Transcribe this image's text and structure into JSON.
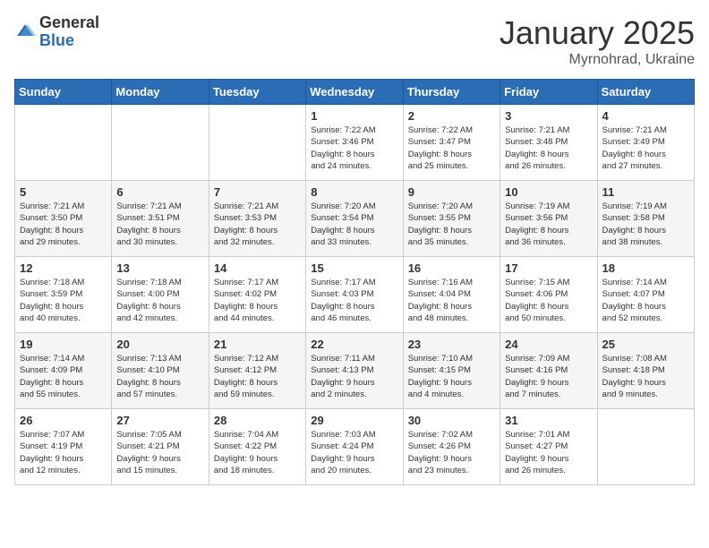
{
  "logo": {
    "general": "General",
    "blue": "Blue"
  },
  "title": "January 2025",
  "location": "Myrnohrad, Ukraine",
  "days_of_week": [
    "Sunday",
    "Monday",
    "Tuesday",
    "Wednesday",
    "Thursday",
    "Friday",
    "Saturday"
  ],
  "weeks": [
    [
      {
        "day": "",
        "info": ""
      },
      {
        "day": "",
        "info": ""
      },
      {
        "day": "",
        "info": ""
      },
      {
        "day": "1",
        "info": "Sunrise: 7:22 AM\nSunset: 3:46 PM\nDaylight: 8 hours\nand 24 minutes."
      },
      {
        "day": "2",
        "info": "Sunrise: 7:22 AM\nSunset: 3:47 PM\nDaylight: 8 hours\nand 25 minutes."
      },
      {
        "day": "3",
        "info": "Sunrise: 7:21 AM\nSunset: 3:48 PM\nDaylight: 8 hours\nand 26 minutes."
      },
      {
        "day": "4",
        "info": "Sunrise: 7:21 AM\nSunset: 3:49 PM\nDaylight: 8 hours\nand 27 minutes."
      }
    ],
    [
      {
        "day": "5",
        "info": "Sunrise: 7:21 AM\nSunset: 3:50 PM\nDaylight: 8 hours\nand 29 minutes."
      },
      {
        "day": "6",
        "info": "Sunrise: 7:21 AM\nSunset: 3:51 PM\nDaylight: 8 hours\nand 30 minutes."
      },
      {
        "day": "7",
        "info": "Sunrise: 7:21 AM\nSunset: 3:53 PM\nDaylight: 8 hours\nand 32 minutes."
      },
      {
        "day": "8",
        "info": "Sunrise: 7:20 AM\nSunset: 3:54 PM\nDaylight: 8 hours\nand 33 minutes."
      },
      {
        "day": "9",
        "info": "Sunrise: 7:20 AM\nSunset: 3:55 PM\nDaylight: 8 hours\nand 35 minutes."
      },
      {
        "day": "10",
        "info": "Sunrise: 7:19 AM\nSunset: 3:56 PM\nDaylight: 8 hours\nand 36 minutes."
      },
      {
        "day": "11",
        "info": "Sunrise: 7:19 AM\nSunset: 3:58 PM\nDaylight: 8 hours\nand 38 minutes."
      }
    ],
    [
      {
        "day": "12",
        "info": "Sunrise: 7:18 AM\nSunset: 3:59 PM\nDaylight: 8 hours\nand 40 minutes."
      },
      {
        "day": "13",
        "info": "Sunrise: 7:18 AM\nSunset: 4:00 PM\nDaylight: 8 hours\nand 42 minutes."
      },
      {
        "day": "14",
        "info": "Sunrise: 7:17 AM\nSunset: 4:02 PM\nDaylight: 8 hours\nand 44 minutes."
      },
      {
        "day": "15",
        "info": "Sunrise: 7:17 AM\nSunset: 4:03 PM\nDaylight: 8 hours\nand 46 minutes."
      },
      {
        "day": "16",
        "info": "Sunrise: 7:16 AM\nSunset: 4:04 PM\nDaylight: 8 hours\nand 48 minutes."
      },
      {
        "day": "17",
        "info": "Sunrise: 7:15 AM\nSunset: 4:06 PM\nDaylight: 8 hours\nand 50 minutes."
      },
      {
        "day": "18",
        "info": "Sunrise: 7:14 AM\nSunset: 4:07 PM\nDaylight: 8 hours\nand 52 minutes."
      }
    ],
    [
      {
        "day": "19",
        "info": "Sunrise: 7:14 AM\nSunset: 4:09 PM\nDaylight: 8 hours\nand 55 minutes."
      },
      {
        "day": "20",
        "info": "Sunrise: 7:13 AM\nSunset: 4:10 PM\nDaylight: 8 hours\nand 57 minutes."
      },
      {
        "day": "21",
        "info": "Sunrise: 7:12 AM\nSunset: 4:12 PM\nDaylight: 8 hours\nand 59 minutes."
      },
      {
        "day": "22",
        "info": "Sunrise: 7:11 AM\nSunset: 4:13 PM\nDaylight: 9 hours\nand 2 minutes."
      },
      {
        "day": "23",
        "info": "Sunrise: 7:10 AM\nSunset: 4:15 PM\nDaylight: 9 hours\nand 4 minutes."
      },
      {
        "day": "24",
        "info": "Sunrise: 7:09 AM\nSunset: 4:16 PM\nDaylight: 9 hours\nand 7 minutes."
      },
      {
        "day": "25",
        "info": "Sunrise: 7:08 AM\nSunset: 4:18 PM\nDaylight: 9 hours\nand 9 minutes."
      }
    ],
    [
      {
        "day": "26",
        "info": "Sunrise: 7:07 AM\nSunset: 4:19 PM\nDaylight: 9 hours\nand 12 minutes."
      },
      {
        "day": "27",
        "info": "Sunrise: 7:05 AM\nSunset: 4:21 PM\nDaylight: 9 hours\nand 15 minutes."
      },
      {
        "day": "28",
        "info": "Sunrise: 7:04 AM\nSunset: 4:22 PM\nDaylight: 9 hours\nand 18 minutes."
      },
      {
        "day": "29",
        "info": "Sunrise: 7:03 AM\nSunset: 4:24 PM\nDaylight: 9 hours\nand 20 minutes."
      },
      {
        "day": "30",
        "info": "Sunrise: 7:02 AM\nSunset: 4:26 PM\nDaylight: 9 hours\nand 23 minutes."
      },
      {
        "day": "31",
        "info": "Sunrise: 7:01 AM\nSunset: 4:27 PM\nDaylight: 9 hours\nand 26 minutes."
      },
      {
        "day": "",
        "info": ""
      }
    ]
  ]
}
